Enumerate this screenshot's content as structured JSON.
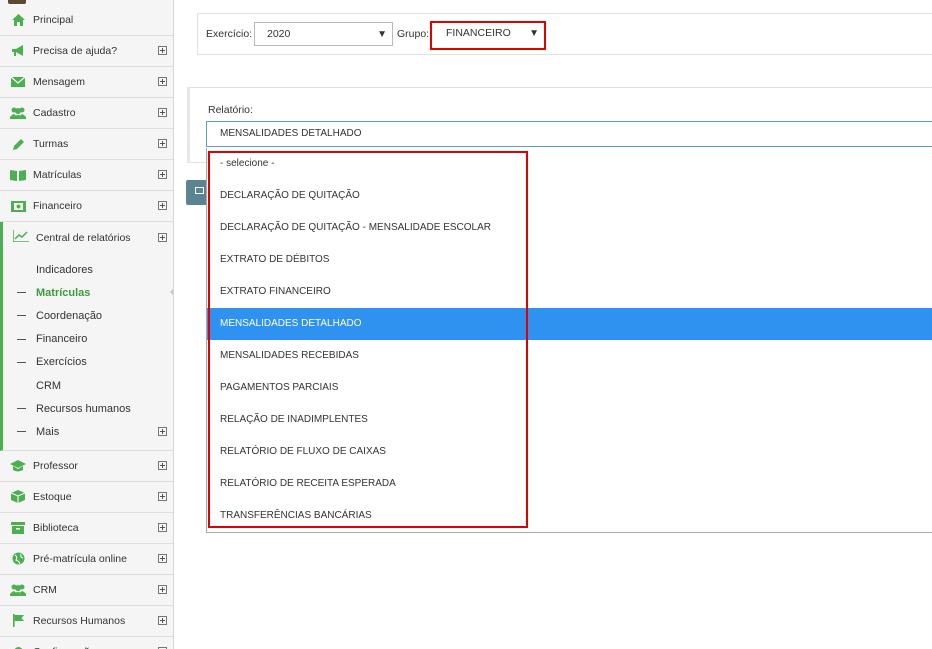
{
  "sidebar": {
    "items_top": [
      {
        "label": "Principal",
        "icon": "home-icon",
        "expandable": false
      },
      {
        "label": "Precisa de ajuda?",
        "icon": "megaphone-icon",
        "expandable": true
      },
      {
        "label": "Mensagem",
        "icon": "envelope-icon",
        "expandable": true
      },
      {
        "label": "Cadastro",
        "icon": "users-icon",
        "expandable": true
      },
      {
        "label": "Turmas",
        "icon": "pencil-icon",
        "expandable": true
      },
      {
        "label": "Matrículas",
        "icon": "book-icon",
        "expandable": true
      },
      {
        "label": "Financeiro",
        "icon": "money-icon",
        "expandable": true
      }
    ],
    "reports": {
      "label": "Central de relatórios",
      "icon": "line-chart-icon",
      "sub_items": [
        {
          "label": "Indicadores",
          "dash": false,
          "active": false,
          "expandable": false
        },
        {
          "label": "Matrículas",
          "dash": true,
          "active": true,
          "expandable": false
        },
        {
          "label": "Coordenação",
          "dash": true,
          "active": false,
          "expandable": false
        },
        {
          "label": "Financeiro",
          "dash": true,
          "active": false,
          "expandable": false
        },
        {
          "label": "Exercícios",
          "dash": true,
          "active": false,
          "expandable": false
        },
        {
          "label": "CRM",
          "dash": false,
          "active": false,
          "expandable": false
        },
        {
          "label": "Recursos humanos",
          "dash": true,
          "active": false,
          "expandable": false
        },
        {
          "label": "Mais",
          "dash": true,
          "active": false,
          "expandable": true
        }
      ]
    },
    "items_bottom": [
      {
        "label": "Professor",
        "icon": "graduation-cap-icon",
        "expandable": true
      },
      {
        "label": "Estoque",
        "icon": "box-icon",
        "expandable": true
      },
      {
        "label": "Biblioteca",
        "icon": "archive-icon",
        "expandable": true
      },
      {
        "label": "Pré-matrícula online",
        "icon": "globe-icon",
        "expandable": true
      },
      {
        "label": "CRM",
        "icon": "users-icon",
        "expandable": true
      },
      {
        "label": "Recursos Humanos",
        "icon": "flag-icon",
        "expandable": true
      },
      {
        "label": "Configurações",
        "icon": "gear-icon",
        "expandable": true
      }
    ]
  },
  "filters": {
    "exercicio_label": "Exercício:",
    "exercicio_value": "2020",
    "grupo_label": "Grupo:",
    "grupo_value": "FINANCEIRO"
  },
  "report": {
    "label": "Relatório:",
    "selected": "MENSALIDADES DETALHADO",
    "options": [
      "- selecione -",
      "DECLARAÇÃO DE QUITAÇÃO",
      "DECLARAÇÃO DE QUITAÇÃO - MENSALIDADE ESCOLAR",
      "EXTRATO DE DÉBITOS",
      "EXTRATO FINANCEIRO",
      "MENSALIDADES DETALHADO",
      "MENSALIDADES RECEBIDAS",
      "PAGAMENTOS PARCIAIS",
      "RELAÇÃO DE INADIMPLENTES",
      "RELATÓRIO DE FLUXO DE CAIXAS",
      "RELATÓRIO DE RECEITA ESPERADA",
      "TRANSFERÊNCIAS BANCÁRIAS"
    ],
    "selected_index": 5
  },
  "colors": {
    "accent_green": "#4caf50",
    "highlight_red": "#e00000",
    "selection_blue": "#2f91f0"
  }
}
